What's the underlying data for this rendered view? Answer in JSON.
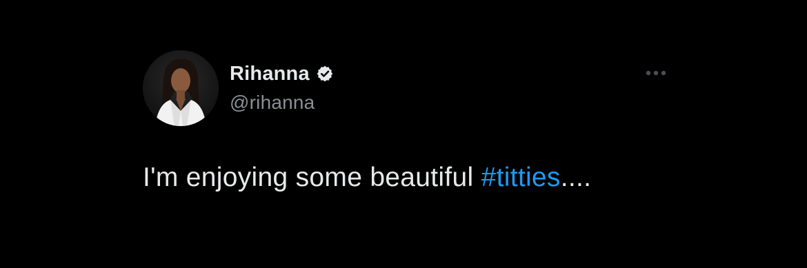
{
  "tweet": {
    "display_name": "Rihanna",
    "handle": "@rihanna",
    "verified": true,
    "text_before": "I'm enjoying some beautiful ",
    "hashtag": "#titties",
    "text_after": "...."
  },
  "icons": {
    "verified": "verified-badge-icon",
    "more": "more-options-icon",
    "avatar": "profile-photo"
  },
  "colors": {
    "background": "#000000",
    "name": "#e7e9ea",
    "handle": "#8b8f94",
    "hashtag": "#1d9bf0",
    "icon_gray": "#4a4d51"
  }
}
